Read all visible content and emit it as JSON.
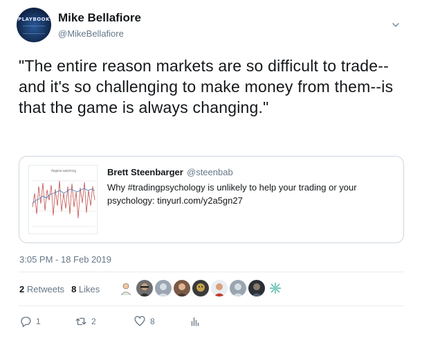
{
  "author": {
    "name": "Mike Bellafiore",
    "handle": "@MikeBellafiore",
    "avatar_text": "PLAYBOOK"
  },
  "tweet": {
    "text": "\"The entire reason markets are so difficult to trade--and it's so challenging to make money from them--is that the game is always changing.\"",
    "timestamp": "3:05 PM - 18 Feb 2019"
  },
  "quoted": {
    "name": "Brett Steenbarger",
    "handle": "@steenbab",
    "text": "Why #tradingpsychology is unlikely to help your trading or your psychology: tinyurl.com/y2a5gn27",
    "thumb_title": "Regime-switching"
  },
  "stats": {
    "retweets_count": "2",
    "retweets_label": "Retweets",
    "likes_count": "8",
    "likes_label": "Likes"
  },
  "actions": {
    "reply_count": "1",
    "retweet_count": "2",
    "like_count": "8"
  },
  "colors": {
    "text": "#14171a",
    "muted": "#657786",
    "border": "#ccd6dd",
    "divider": "#e6ecf0"
  },
  "icons": [
    "chevron-down-icon",
    "reply-icon",
    "retweet-icon",
    "heart-icon",
    "analytics-icon"
  ]
}
